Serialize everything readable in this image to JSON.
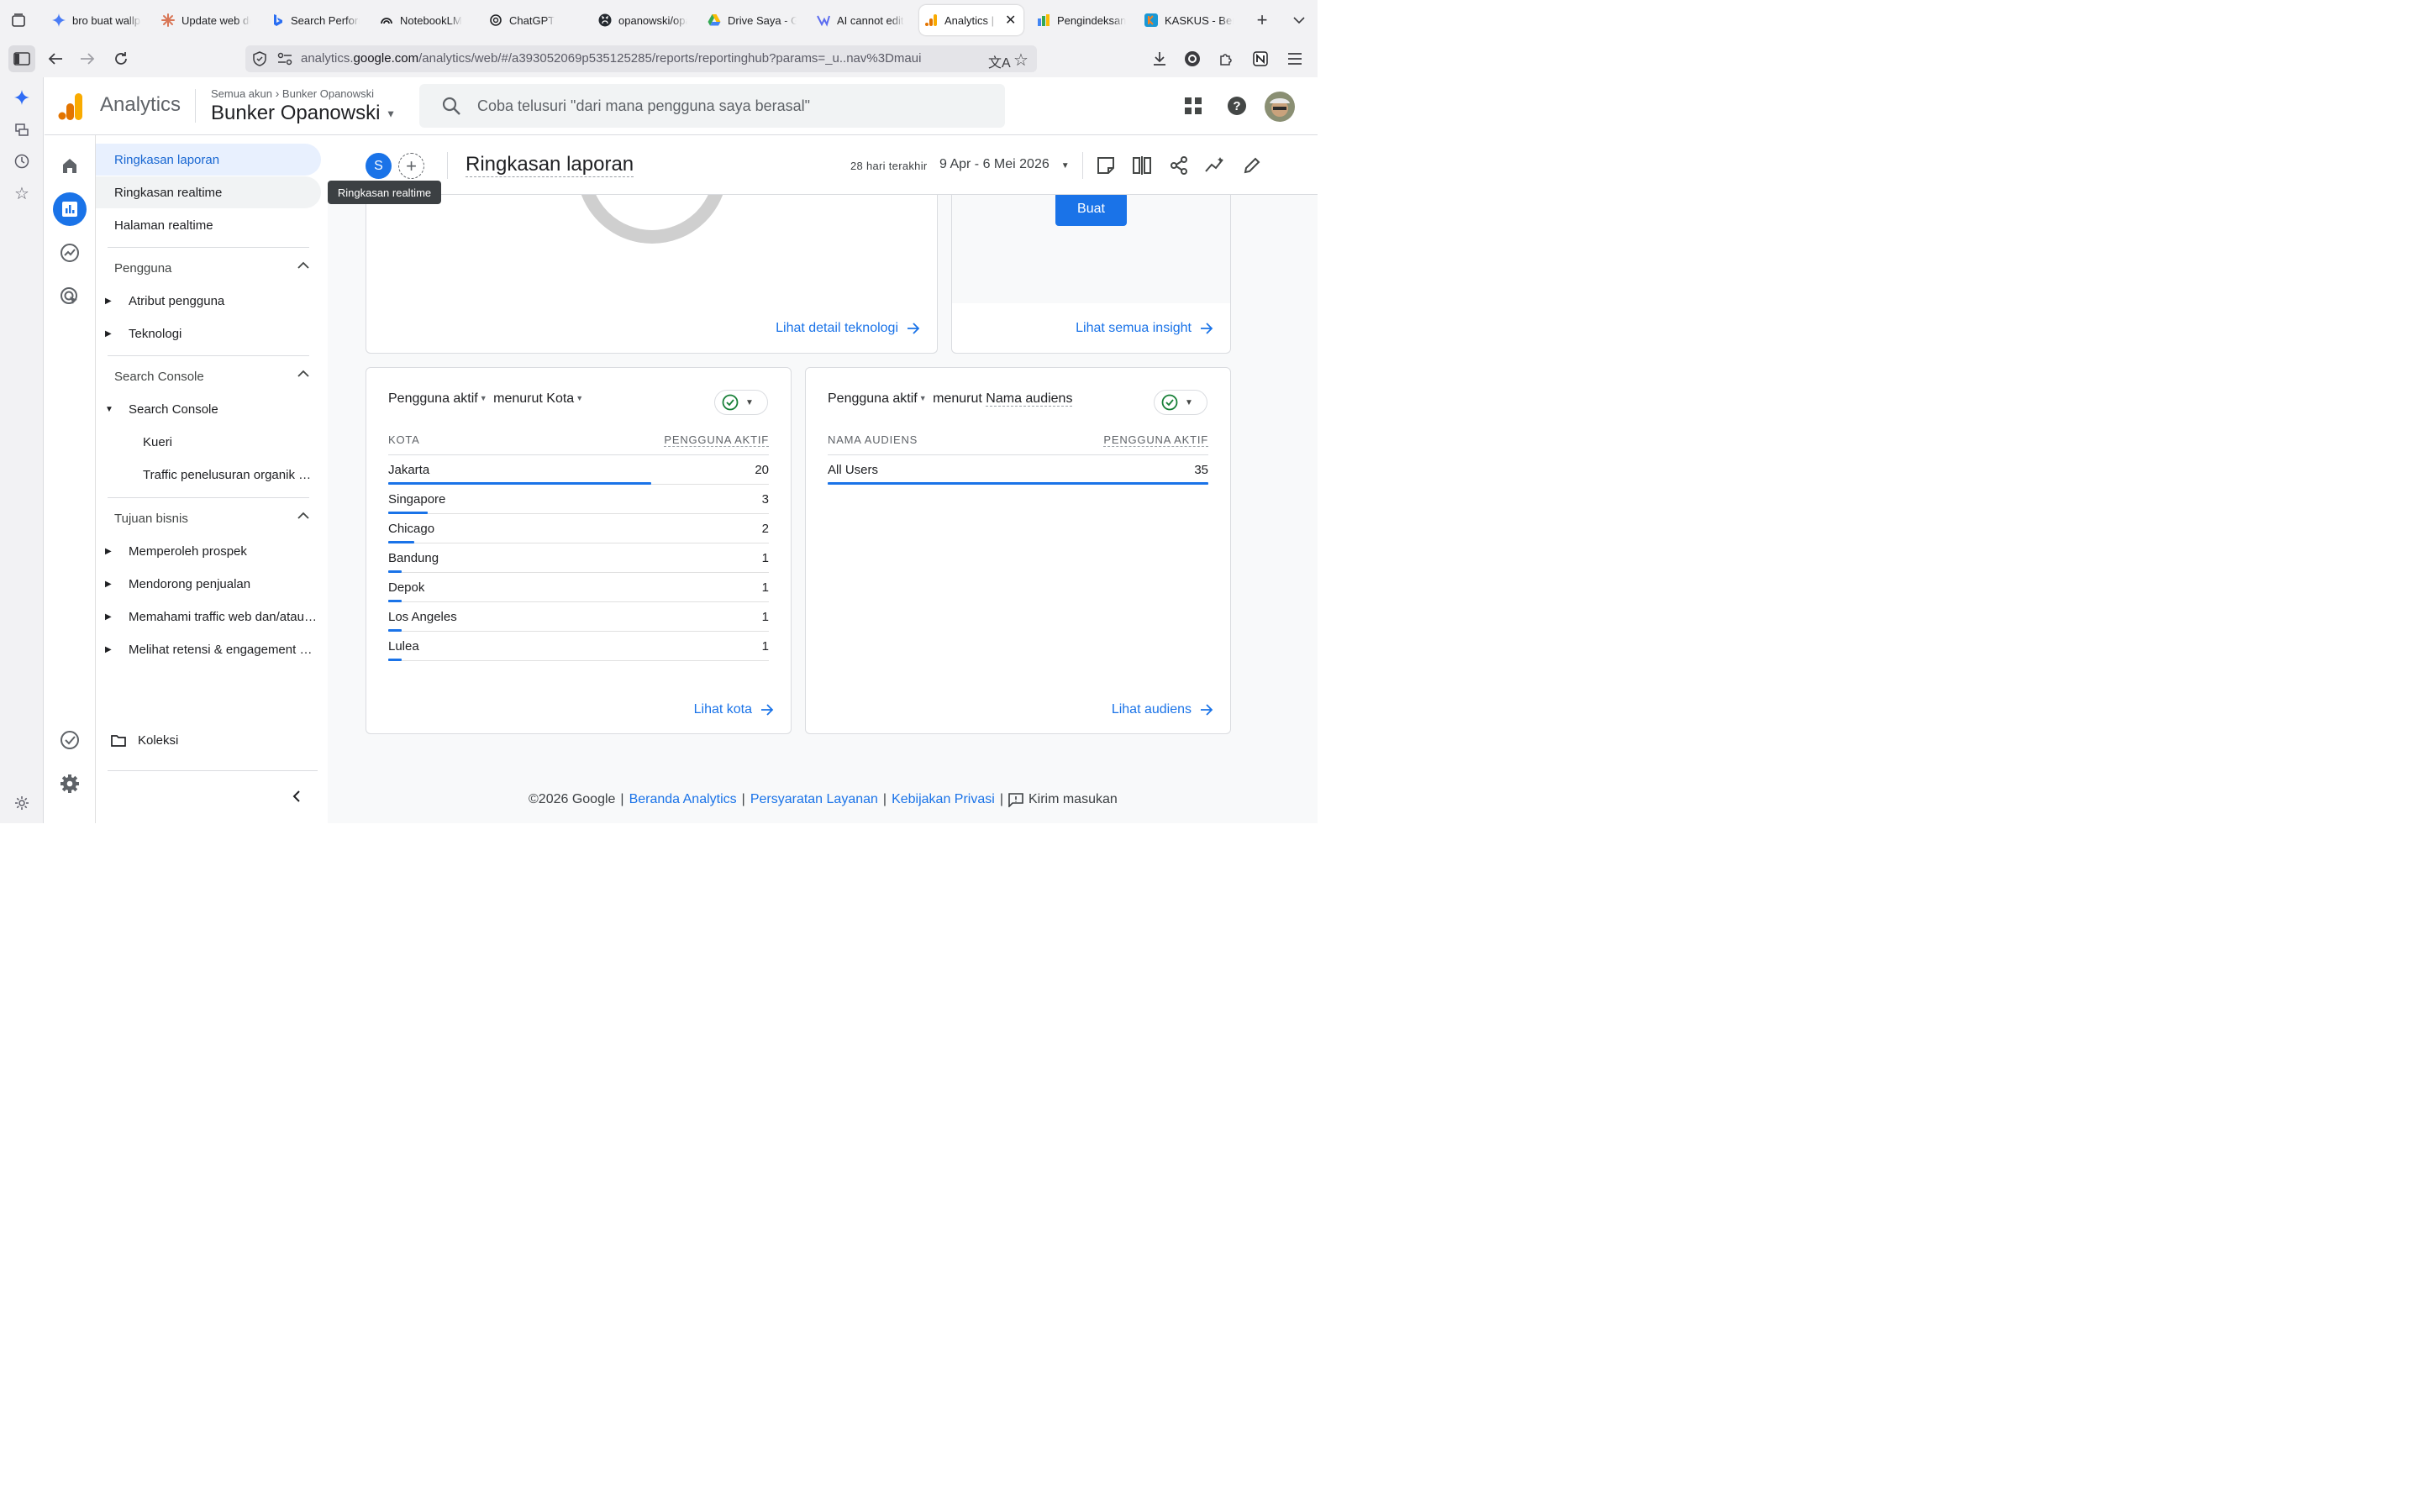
{
  "browser": {
    "tabs": [
      {
        "label": "bro buat wallpaper",
        "icon": "gemini-sparkle-icon",
        "active": false
      },
      {
        "label": "Update web dengan",
        "icon": "claude-asterisk-icon",
        "active": false
      },
      {
        "label": "Search Performance",
        "icon": "bing-icon",
        "active": false
      },
      {
        "label": "NotebookLM",
        "icon": "notebooklm-icon",
        "active": false
      },
      {
        "label": "ChatGPT",
        "icon": "openai-icon",
        "active": false
      },
      {
        "label": "opanowski/opanowski",
        "icon": "github-icon",
        "active": false
      },
      {
        "label": "Drive Saya - Google",
        "icon": "google-drive-icon",
        "active": false
      },
      {
        "label": "AI cannot edit",
        "icon": "claude-code-icon",
        "active": false
      },
      {
        "label": "Analytics | Ringkasan",
        "icon": "analytics-icon",
        "active": true
      },
      {
        "label": "Pengindeksan",
        "icon": "search-console-icon",
        "active": false
      },
      {
        "label": "KASKUS - Berbagi",
        "icon": "kaskus-icon",
        "active": false
      }
    ],
    "url": {
      "prefix": "analytics.",
      "domain": "google.com",
      "path": "/analytics/web/#/a393052069p535125285/reports/reportinghub?params=_u..nav%3Dmaui"
    }
  },
  "ga": {
    "product_title": "Analytics",
    "breadcrumb": {
      "all_accounts": "Semua akun",
      "account": "Bunker Opanowski"
    },
    "property_name": "Bunker Opanowski",
    "search_placeholder": "Coba telusuri \"dari mana pengguna saya berasal\""
  },
  "nav": {
    "items_top": [
      {
        "label": "Ringkasan laporan",
        "active": true
      },
      {
        "label": "Ringkasan realtime",
        "active": false
      },
      {
        "label": "Halaman realtime",
        "active": false
      }
    ],
    "section_pengguna": {
      "title": "Pengguna",
      "items": [
        "Atribut pengguna",
        "Teknologi"
      ]
    },
    "section_search_console": {
      "title": "Search Console",
      "group": "Search Console",
      "subitems": [
        "Kueri",
        "Traffic penelusuran organik Google"
      ]
    },
    "section_tujuan": {
      "title": "Tujuan bisnis",
      "items": [
        "Memperoleh prospek",
        "Mendorong penjualan",
        "Memahami traffic web dan/atau aplikasi",
        "Melihat retensi & engagement pengguna"
      ]
    },
    "koleksi": "Koleksi"
  },
  "report": {
    "avatar_letter": "S",
    "title": "Ringkasan laporan",
    "date_label": "28 hari terakhir",
    "date_range": "9 Apr - 6 Mei 2026",
    "tooltip": "Ringkasan realtime"
  },
  "cards": {
    "tech_link": "Lihat detail teknologi",
    "insight_button": "Buat",
    "insight_link": "Lihat semua insight",
    "city": {
      "metric": "Pengguna aktif",
      "by": "menurut",
      "dimension": "Kota",
      "col_left": "KOTA",
      "col_right": "PENGGUNA AKTIF",
      "rows": [
        {
          "label": "Jakarta",
          "value": "20",
          "share": 1.0
        },
        {
          "label": "Singapore",
          "value": "3",
          "share": 0.15
        },
        {
          "label": "Chicago",
          "value": "2",
          "share": 0.1
        },
        {
          "label": "Bandung",
          "value": "1",
          "share": 0.05
        },
        {
          "label": "Depok",
          "value": "1",
          "share": 0.05
        },
        {
          "label": "Los Angeles",
          "value": "1",
          "share": 0.05
        },
        {
          "label": "Lulea",
          "value": "1",
          "share": 0.05
        }
      ],
      "link": "Lihat kota"
    },
    "audience": {
      "metric": "Pengguna aktif",
      "by": "menurut",
      "dimension": "Nama audiens",
      "col_left": "NAMA AUDIENS",
      "col_right": "PENGGUNA AKTIF",
      "rows": [
        {
          "label": "All Users",
          "value": "35",
          "share": 1.0
        }
      ],
      "link": "Lihat audiens"
    }
  },
  "footer": {
    "copyright": "©2026 Google",
    "links": [
      "Beranda Analytics",
      "Persyaratan Layanan",
      "Kebijakan Privasi"
    ],
    "feedback": "Kirim masukan"
  },
  "colors": {
    "accent": "#1a73e8",
    "analytics_orange": "#f9ab00",
    "analytics_dark_orange": "#e37400",
    "success_green": "#188038"
  }
}
